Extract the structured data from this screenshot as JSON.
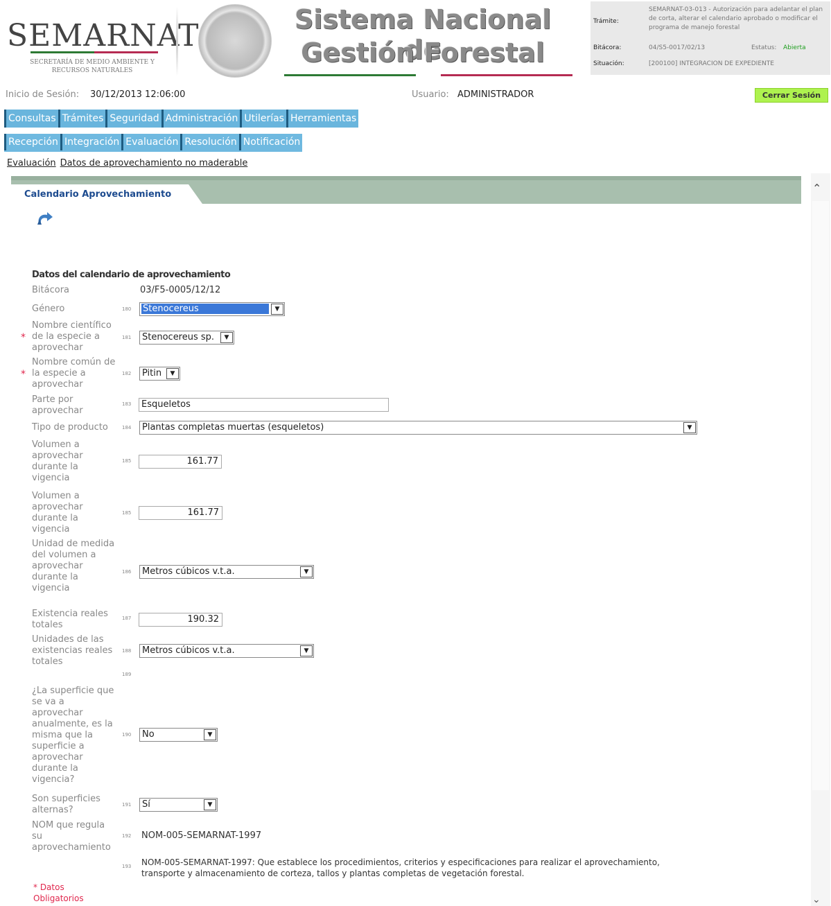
{
  "header": {
    "logo": "SEMARNAT",
    "logo_sub": "SECRETARÍA DE MEDIO AMBIENTE Y RECURSOS NATURALES",
    "title_line1": "Sistema Nacional de",
    "title_line2": "Gestión Forestal",
    "info": {
      "tramite_label": "Trámite:",
      "tramite_value": "SEMARNAT-03-013 - Autorización para adelantar el plan de corta, alterar el calendario aprobado o modificar el programa de manejo forestal",
      "bitacora_label": "Bitácora:",
      "bitacora_value": "04/S5-0017/02/13",
      "estatus_label": "Estatus:",
      "estatus_value": "Abierta",
      "situacion_label": "Situación:",
      "situacion_value": "[200100] INTEGRACION DE EXPEDIENTE"
    }
  },
  "session": {
    "login_label": "Inicio de Sesión:",
    "login_value": "30/12/2013 12:06:00",
    "user_label": "Usuario:",
    "user_value": "ADMINISTRADOR",
    "logout": "Cerrar Sesión"
  },
  "menu_main": [
    "Consultas",
    "Trámites",
    "Seguridad",
    "Administración",
    "Utilerías",
    "Herramientas"
  ],
  "menu_sub": [
    "Recepción",
    "Integración",
    "Evaluación",
    "Resolución",
    "Notificación"
  ],
  "breadcrumb": [
    "Evaluación",
    "Datos de aprovechamiento no maderable"
  ],
  "panel": {
    "tab_title": "Calendario Aprovechamiento",
    "form_title": "Datos del calendario de aprovechamiento",
    "fields": {
      "bitacora_label": "Bitácora",
      "bitacora_value": "03/F5-0005/12/12",
      "genero_label": "Género",
      "genero_num": "180",
      "genero_value": "Stenocereus",
      "nombre_cient_label": "Nombre científico de la especie a aprovechar",
      "nombre_cient_num": "181",
      "nombre_cient_value": "Stenocereus sp.",
      "nombre_comun_label": "Nombre común de la especie a aprovechar",
      "nombre_comun_num": "182",
      "nombre_comun_value": "Pitin",
      "parte_label": "Parte por aprovechar",
      "parte_num": "183",
      "parte_value": "Esqueletos",
      "tipo_label": "Tipo de producto",
      "tipo_num": "184",
      "tipo_value": "Plantas completas muertas (esqueletos)",
      "vol1_label": "Volumen a aprovechar durante la vigencia",
      "vol1_num": "185",
      "vol1_value": "161.77",
      "vol2_label": "Volumen a aprovechar durante la vigencia",
      "vol2_num": "185",
      "vol2_value": "161.77",
      "unidad_label": "Unidad de medida del volumen a aprovechar durante la vigencia",
      "unidad_num": "186",
      "unidad_value": "Metros cúbicos v.t.a.",
      "exist_label": "Existencia reales totales",
      "exist_num": "187",
      "exist_value": "190.32",
      "unid_exist_label": "Unidades de las existencias reales totales",
      "unid_exist_num": "188",
      "unid_exist_value": "Metros cúbicos v.t.a.",
      "blank_num": "189",
      "superficie_label": "¿La superficie que se va a aprovechar anualmente, es la misma que la superficie a aprovechar durante la vigencia?",
      "superficie_num": "190",
      "superficie_value": "No",
      "alternas_label": "Son superficies alternas?",
      "alternas_num": "191",
      "alternas_value": "Sí",
      "nom_label": "NOM que regula su aprovechamiento",
      "nom_num": "192",
      "nom_value": "NOM-005-SEMARNAT-1997",
      "nom_desc_num": "193",
      "nom_desc": "NOM-005-SEMARNAT-1997: Que establece los procedimientos, criterios y especificaciones para realizar el aprovechamiento, transporte y almacenamiento de corteza, tallos y plantas completas de vegetación forestal."
    },
    "required_note": "* Datos Obligatorios"
  },
  "colors": {
    "menu_bg": "#69b5dd",
    "tab_bar": "#a8bfae",
    "logout_bg": "#aef24f",
    "required": "#e0274d",
    "tab_title": "#1d4b8f"
  }
}
